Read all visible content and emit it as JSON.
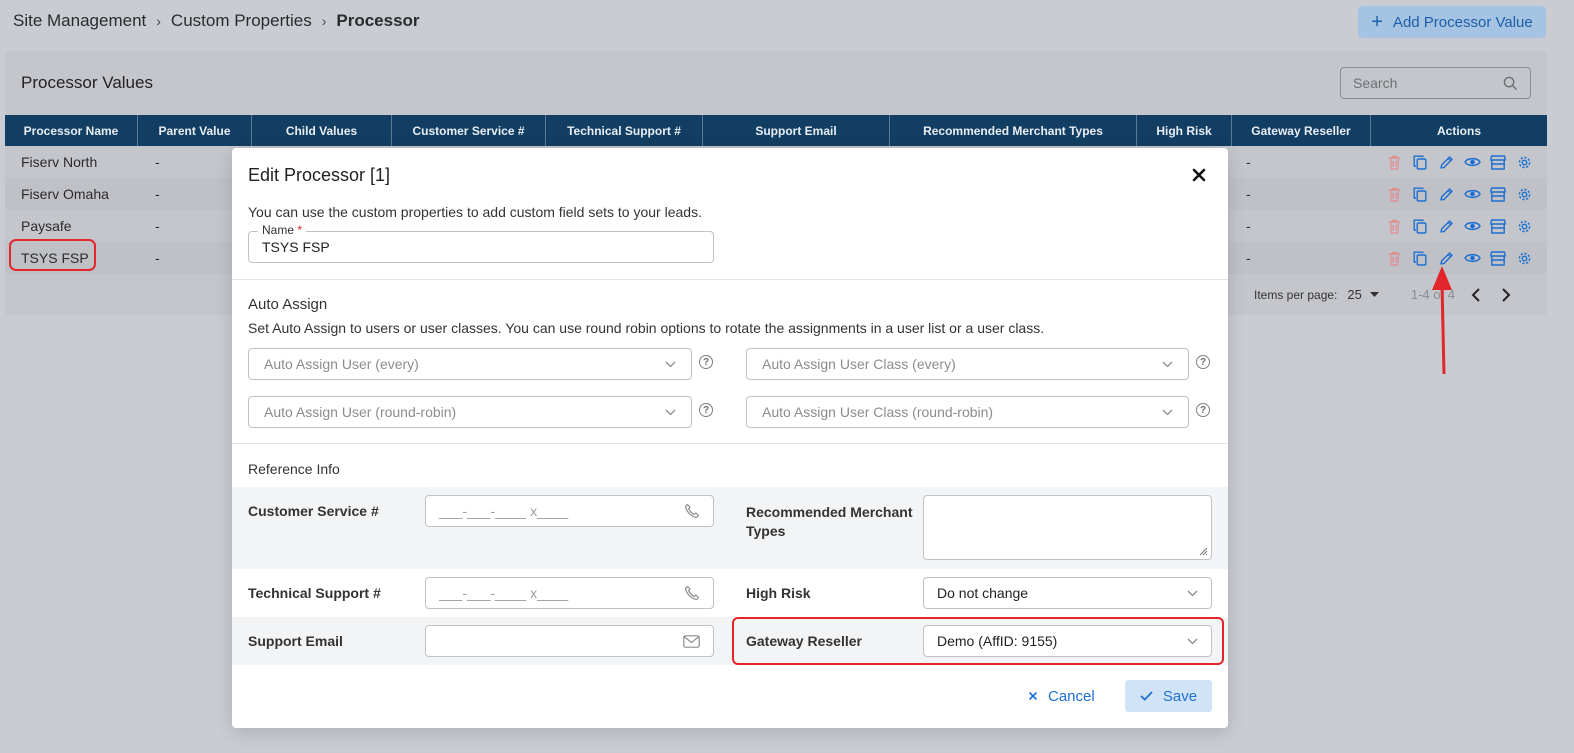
{
  "breadcrumb": {
    "items": [
      "Site Management",
      "Custom Properties"
    ],
    "current": "Processor"
  },
  "header": {
    "add_button_label": "Add Processor Value"
  },
  "card": {
    "title": "Processor Values",
    "search_placeholder": "Search"
  },
  "table": {
    "columns": [
      "Processor Name",
      "Parent Value",
      "Child Values",
      "Customer Service #",
      "Technical Support #",
      "Support Email",
      "Recommended Merchant Types",
      "High Risk",
      "Gateway Reseller",
      "Actions"
    ],
    "rows": [
      {
        "name": "Fiserv North",
        "parent": "-",
        "gateway": "-"
      },
      {
        "name": "Fiserv Omaha",
        "parent": "-",
        "gateway": "-"
      },
      {
        "name": "Paysafe",
        "parent": "-",
        "gateway": "-"
      },
      {
        "name": "TSYS FSP",
        "parent": "-",
        "gateway": "-"
      }
    ],
    "action_icons": [
      "trash-icon",
      "copy-icon",
      "pencil-icon",
      "eye-icon",
      "store-icon",
      "gear-icon"
    ]
  },
  "pager": {
    "items_per_page_label": "Items per page:",
    "items_per_page_value": "25",
    "range": "1-4 of 4"
  },
  "modal": {
    "title": "Edit Processor [1]",
    "description": "You can use the custom properties to add custom field sets to your leads.",
    "name_label": "Name",
    "name_required_mark": "*",
    "name_value": "TSYS FSP",
    "auto_assign": {
      "title": "Auto Assign",
      "description": "Set Auto Assign to users or user classes. You can use round robin options to rotate the assignments in a user list or a user class.",
      "user_every": "Auto Assign User (every)",
      "class_every": "Auto Assign User Class (every)",
      "user_rr": "Auto Assign User (round-robin)",
      "class_rr": "Auto Assign User Class (round-robin)",
      "help_glyph": "?"
    },
    "reference": {
      "title": "Reference Info",
      "customer_service_label": "Customer Service #",
      "customer_service_placeholder": "___-___-____ x____",
      "recommended_label_line1": "Recommended Merchant",
      "recommended_label_line2": "Types",
      "technical_support_label": "Technical Support #",
      "technical_support_placeholder": "___-___-____ x____",
      "high_risk_label": "High Risk",
      "high_risk_value": "Do not change",
      "support_email_label": "Support Email",
      "gateway_reseller_label": "Gateway Reseller",
      "gateway_reseller_value": "Demo (AffID: 9155)"
    },
    "cancel_label": "Cancel",
    "save_label": "Save"
  },
  "colors": {
    "table_header": "#123e63",
    "accent": "#1d6fd1",
    "highlight": "#e3262b",
    "delete_icon": "#e08a8d"
  }
}
